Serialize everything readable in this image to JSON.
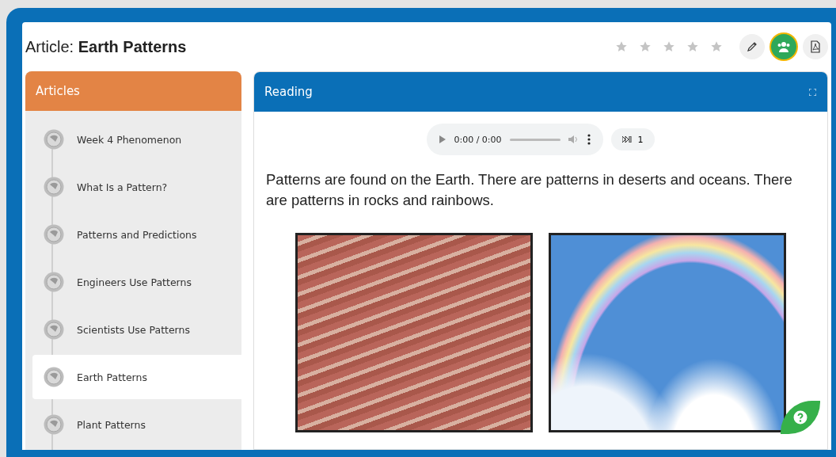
{
  "header": {
    "label": "Article:",
    "title": "Earth Patterns",
    "stars": 0
  },
  "toolbar": [
    {
      "kind": "edit",
      "selected": false
    },
    {
      "kind": "group",
      "selected": true
    },
    {
      "kind": "pdf",
      "selected": false
    }
  ],
  "articles": {
    "title": "Articles",
    "items": [
      {
        "label": "Week 4 Phenomenon",
        "selected": false
      },
      {
        "label": "What Is a Pattern?",
        "selected": false
      },
      {
        "label": "Patterns and Predictions",
        "selected": false
      },
      {
        "label": "Engineers Use Patterns",
        "selected": false
      },
      {
        "label": "Scientists Use Patterns",
        "selected": false
      },
      {
        "label": "Earth Patterns",
        "selected": true
      },
      {
        "label": "Plant Patterns",
        "selected": false
      }
    ]
  },
  "reading": {
    "title": "Reading",
    "audio": {
      "time": "0:00 / 0:00",
      "speed": "1"
    },
    "text": "Patterns are found on the Earth. There are patterns in deserts and oceans. There are patterns in rocks and rainbows.",
    "images": [
      {
        "kind": "rock"
      },
      {
        "kind": "rainbow"
      }
    ]
  }
}
